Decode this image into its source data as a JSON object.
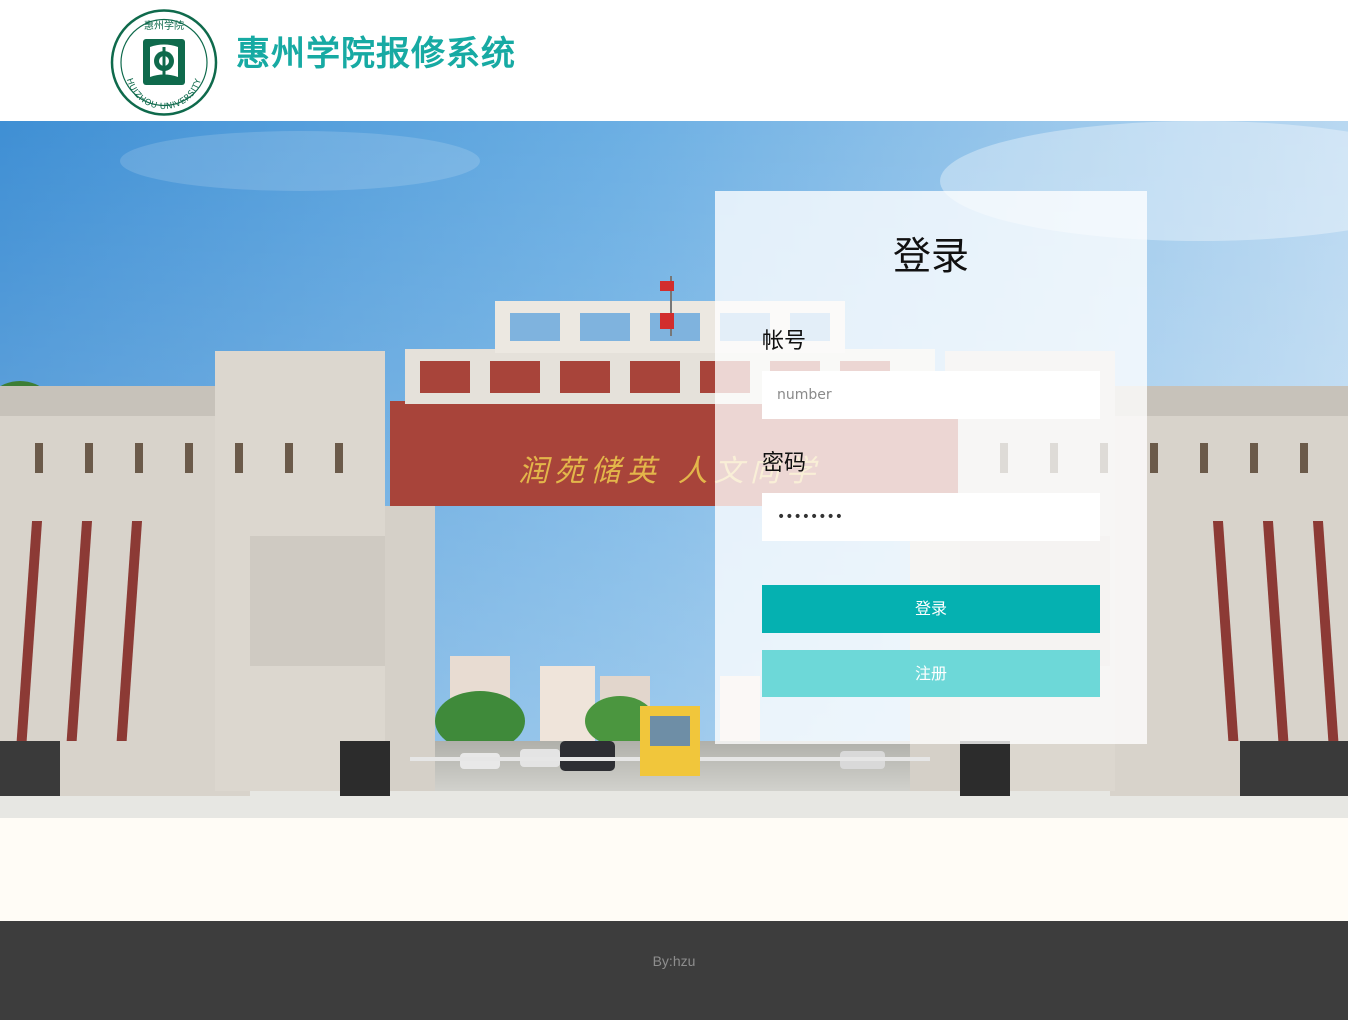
{
  "header": {
    "title": "惠州学院报修系统",
    "logo_text_top": "惠州学院",
    "logo_text_bottom": "HUIZHOU UNIVERSITY",
    "brand_color": "#17aaa3"
  },
  "hero": {
    "gate_inscription": "润苑储英  人文向学"
  },
  "login": {
    "title": "登录",
    "account_label": "帐号",
    "account_placeholder": "number",
    "password_label": "密码",
    "password_value": "••••••••",
    "login_button": "登录",
    "register_button": "注册",
    "login_color": "#05b1b1",
    "register_color": "#6dd8d8"
  },
  "footer": {
    "text": "By:hzu"
  }
}
